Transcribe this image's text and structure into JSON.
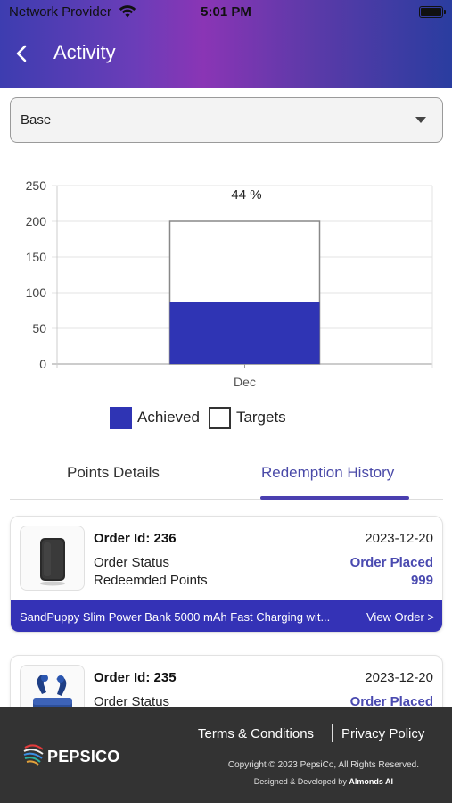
{
  "status_bar": {
    "carrier": "Network Provider",
    "time": "5:01 PM",
    "wifi_icon": "wifi-icon",
    "battery_icon": "battery-icon"
  },
  "header": {
    "title": "Activity",
    "back_icon": "chevron-left-icon"
  },
  "filter": {
    "selected": "Base",
    "caret_icon": "caret-down-icon"
  },
  "chart_data": {
    "type": "bar",
    "categories": [
      "Dec"
    ],
    "series": [
      {
        "name": "Achieved",
        "values": [
          87
        ],
        "color": "#2f34b4"
      },
      {
        "name": "Targets",
        "values": [
          200
        ],
        "color": "#ffffff"
      }
    ],
    "data_labels": [
      "44 %"
    ],
    "yticks": [
      "0",
      "50",
      "100",
      "150",
      "200",
      "250"
    ],
    "ylim": [
      0,
      250
    ],
    "grid": true,
    "legend_position": "bottom"
  },
  "tabs": [
    {
      "label": "Points Details",
      "active": false
    },
    {
      "label": "Redemption History",
      "active": true
    }
  ],
  "orders": [
    {
      "order_id": "Order Id: 236",
      "date": "2023-12-20",
      "status_label": "Order Status",
      "status_value": "Order Placed",
      "points_label": "Redeemded Points",
      "points_value": "999",
      "product_name": "SandPuppy Slim Power Bank 5000 mAh Fast Charging wit...",
      "view_label": "View Order >"
    },
    {
      "order_id": "Order Id: 235",
      "date": "2023-12-20",
      "status_label": "Order Status",
      "status_value": "Order Placed"
    }
  ],
  "footer": {
    "terms": "Terms & Conditions",
    "privacy": "Privacy Policy",
    "brand": "PEPSICO",
    "copyright": "Copyright © 2023 PepsiCo, All Rights Reserved.",
    "designed_prefix": "Designed & Developed by ",
    "designed_by": "Almonds AI"
  },
  "colors": {
    "accent": "#3432b6",
    "link": "#4a4ab0",
    "footer_bg": "#333333"
  }
}
